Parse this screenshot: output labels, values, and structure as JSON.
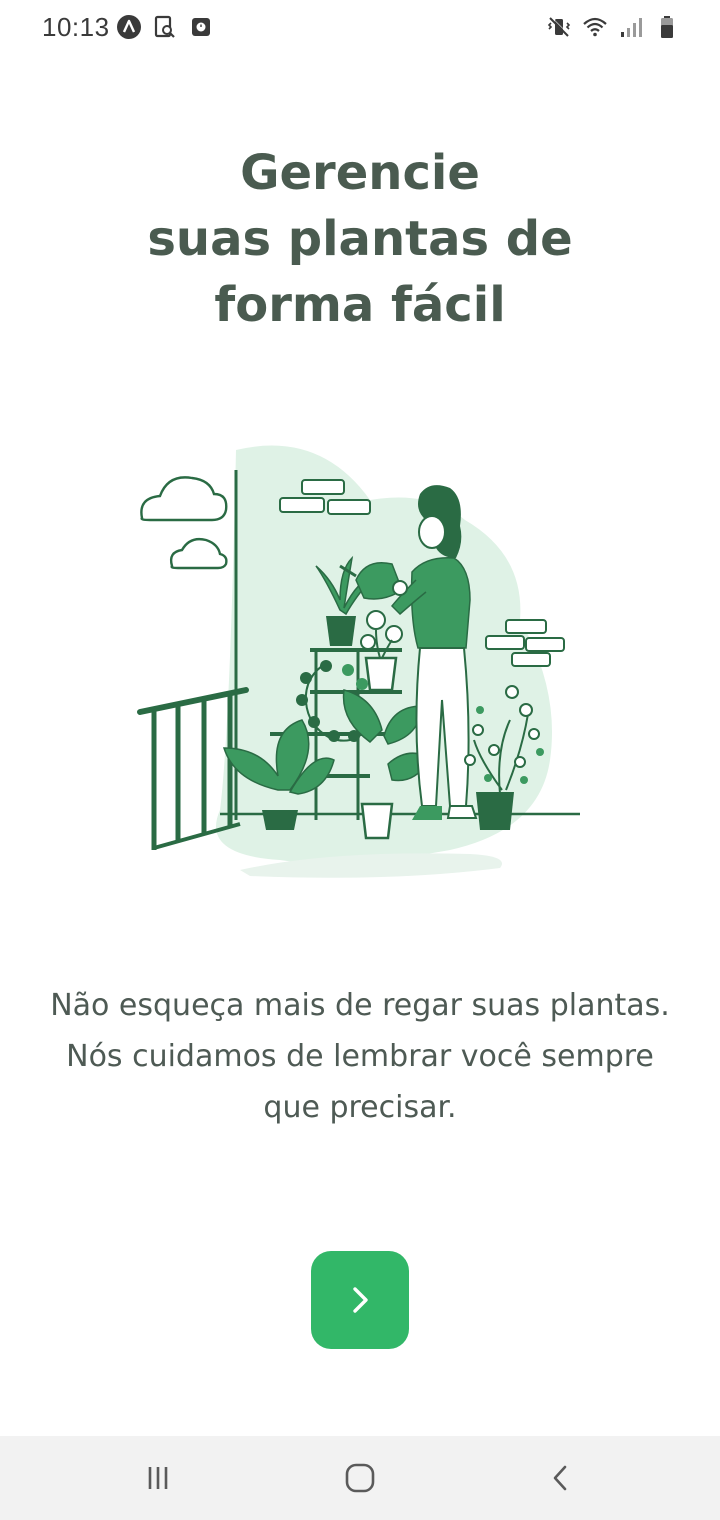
{
  "status_bar": {
    "time": "10:13",
    "left_icons": [
      "app-a-icon",
      "search-doc-icon",
      "media-icon"
    ],
    "right_icons": [
      "vibrate-mute-icon",
      "wifi-icon",
      "signal-icon",
      "battery-icon"
    ]
  },
  "onboarding": {
    "title": "Gerencie\nsuas plantas de\nforma fácil",
    "illustration": "woman-watering-plants-illustration",
    "subtitle": "Não esqueça mais de regar suas plantas.\nNós cuidamos de lembrar você sempre\nque precisar.",
    "next_button_icon": "chevron-right-icon"
  },
  "nav_bar": {
    "buttons": [
      "recent-apps-icon",
      "home-icon",
      "back-icon"
    ]
  },
  "colors": {
    "accent": "#32b768",
    "title": "#4a5b50",
    "subtitle": "#4e5a54",
    "plant_dark": "#2a6b44",
    "plant_light": "#d6efe0"
  }
}
